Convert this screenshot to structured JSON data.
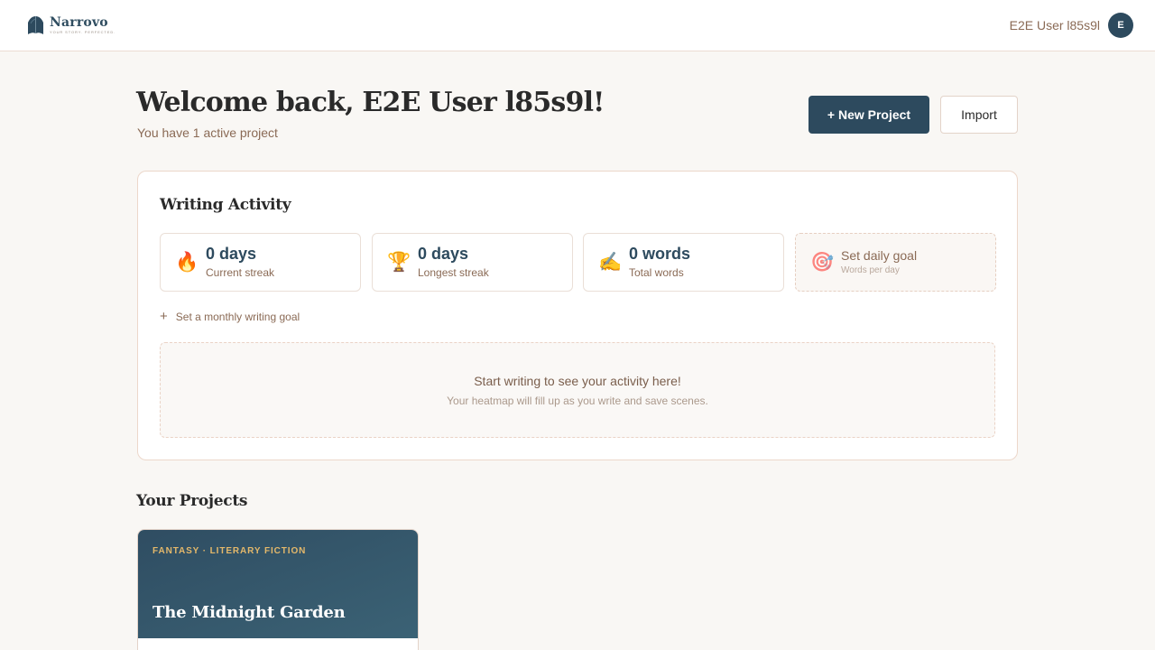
{
  "header": {
    "brand_name": "Narrovo",
    "brand_tagline": "Your story. Perfected.",
    "user_name": "E2E User l85s9l",
    "avatar_initial": "E",
    "brand_color": "#2d4a5e"
  },
  "welcome": {
    "title": "Welcome back, E2E User l85s9l!",
    "subtitle": "You have 1 active project",
    "new_project_label": "+ New Project",
    "import_label": "Import"
  },
  "activity": {
    "title": "Writing Activity",
    "stats": [
      {
        "icon": "fire-icon",
        "glyph": "🔥",
        "value": "0 days",
        "label": "Current streak"
      },
      {
        "icon": "trophy-icon",
        "glyph": "🏆",
        "value": "0 days",
        "label": "Longest streak"
      },
      {
        "icon": "writing-hand-icon",
        "glyph": "✍️",
        "value": "0 words",
        "label": "Total words"
      },
      {
        "icon": "target-icon",
        "glyph": "🎯",
        "value": "Set daily goal",
        "label": "Words per day"
      }
    ],
    "monthly_goal_label": "Set a monthly writing goal",
    "plus_glyph": "+",
    "empty_title": "Start writing to see your activity here!",
    "empty_subtitle": "Your heatmap will fill up as you write and save scenes."
  },
  "projects": {
    "title": "Your Projects",
    "items": [
      {
        "genre": "Fantasy · Literary Fiction",
        "title": "The Midnight Garden"
      }
    ]
  }
}
